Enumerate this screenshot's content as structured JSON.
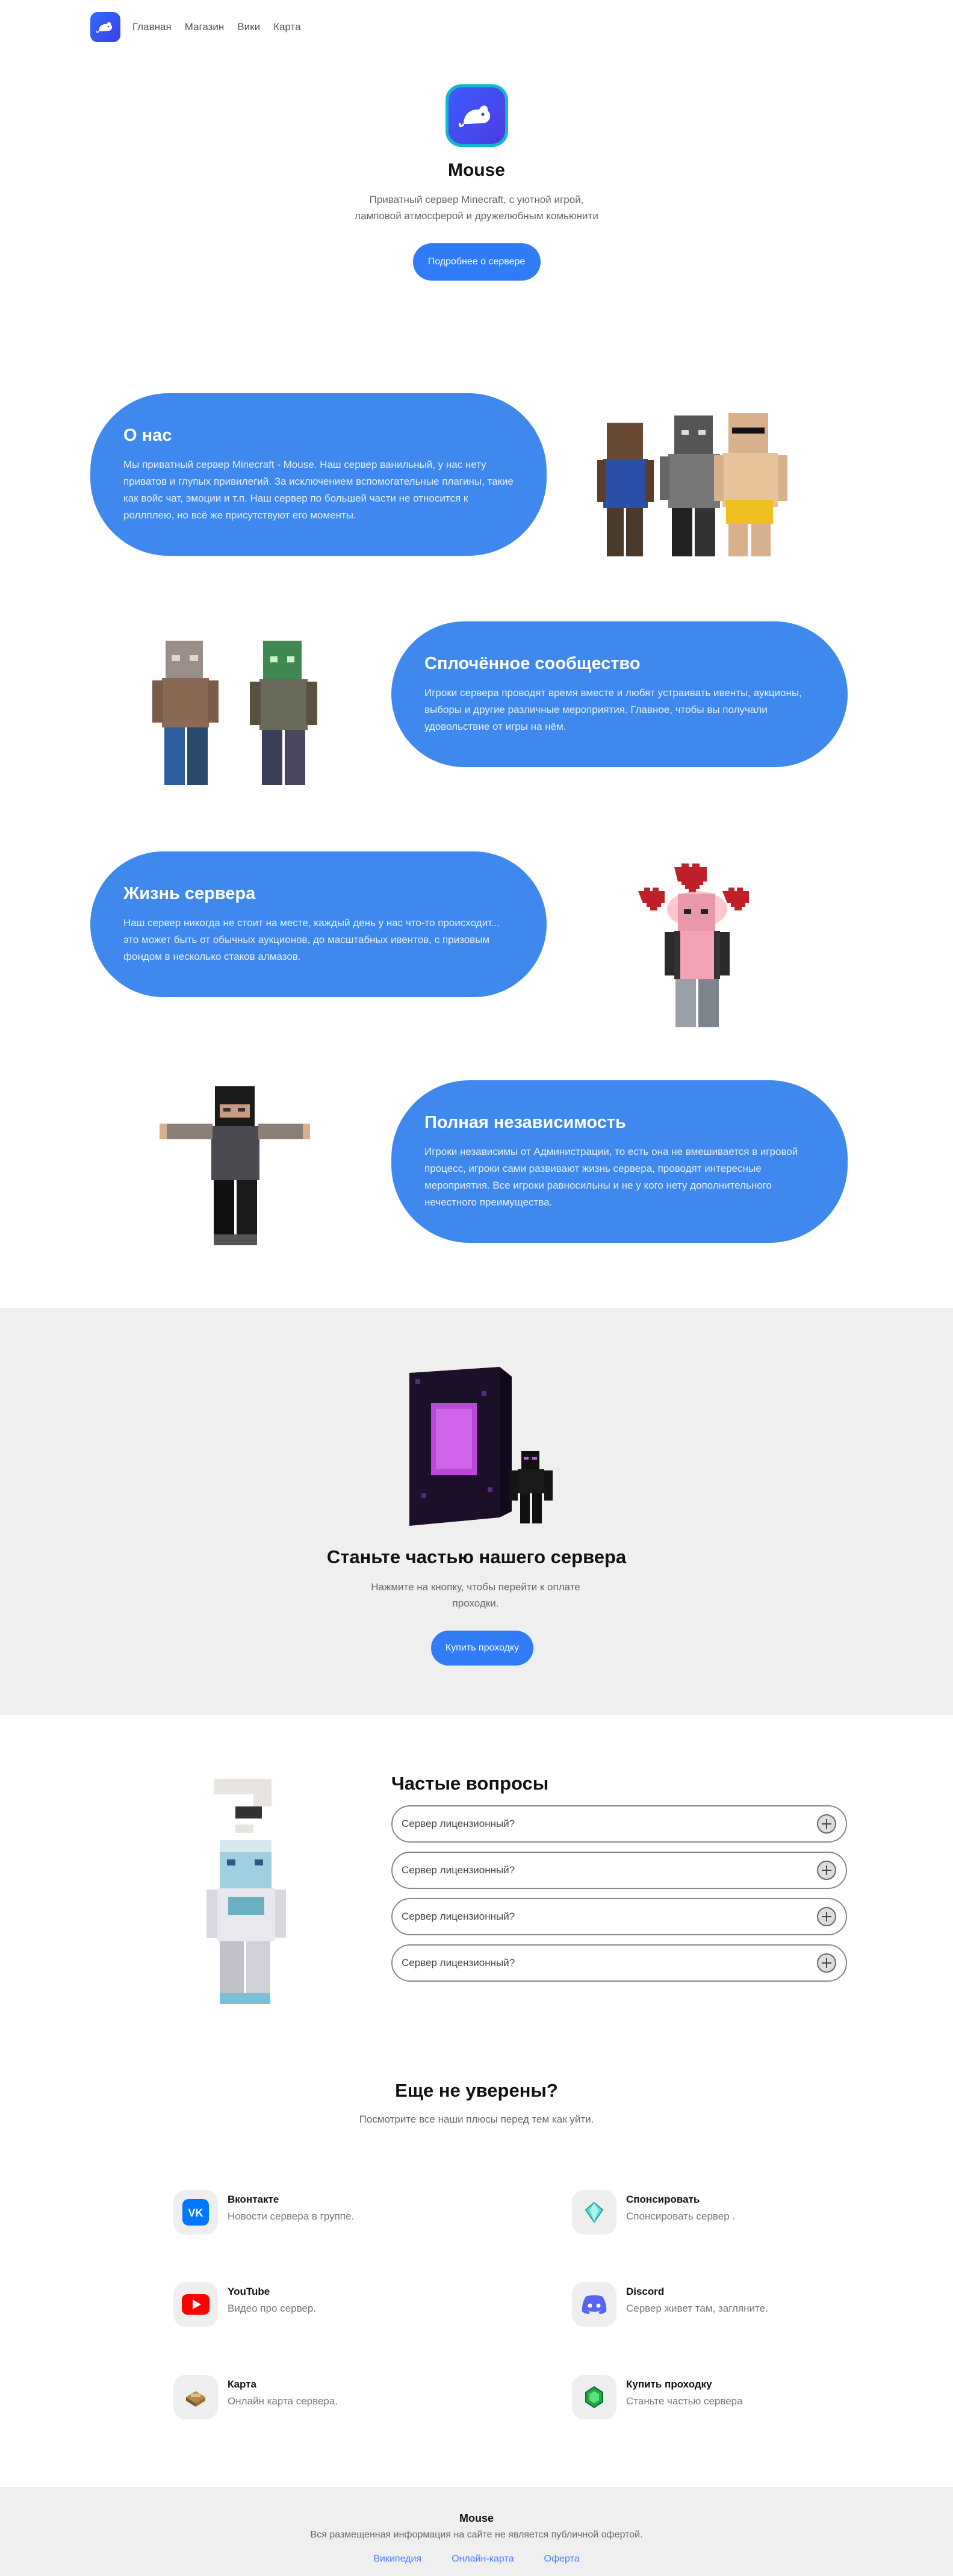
{
  "nav": {
    "links": [
      "Главная",
      "Магазин",
      "Вики",
      "Карта"
    ]
  },
  "hero": {
    "title": "Mouse",
    "description": "Приватный сервер Minecraft, с уютной игрой, ламповой атмосферой и дружелюбным комьюнити",
    "button": "Подробнее о сервере"
  },
  "sections": [
    {
      "title": "О нас",
      "text": "Мы приватный сервер Minecraft - Mouse. Наш сервер ванильный, у нас нету приватов и глупых привилегий. За исключением вспомогательные плагины, такие как войс чат, эмоции и т.п. Наш сервер по большей части не относится к роллплею, но всё же присутствуют его моменты."
    },
    {
      "title": "Сплочённое сообщество",
      "text": "Игроки сервера проводят время вместе и любят устраивать ивенты, аукционы, выборы и другие различные мероприятия. Главное, чтобы вы получали удовольствие от игры на нём."
    },
    {
      "title": "Жизнь сервера",
      "text": "Наш сервер никогда не стоит на месте, каждый день у нас что-то происходит... это может быть от обычных аукционов, до масштабных ивентов, с призовым фондом в несколько стаков алмазов."
    },
    {
      "title": "Полная независимость",
      "text": "Игроки независимы от Администрации, то есть она не вмешивается в игровой процесс, игроки сами развивают жизнь сервера, проводят интересные мероприятия. Все игроки равносильны и не у кого нету дополнительного нечестного преимущества."
    }
  ],
  "join": {
    "title": "Станьте частью нашего сервера",
    "text": "Нажмите на кнопку, чтобы перейти к оплате проходки.",
    "button": "Купить проходку"
  },
  "faq": {
    "title": "Частые вопросы",
    "items": [
      "Сервер лицензионный?",
      "Сервер лицензионный?",
      "Сервер лицензионный?",
      "Сервер лицензионный?"
    ]
  },
  "unsure": {
    "title": "Еще не уверены?",
    "subtitle": "Посмотрите все наши плюсы перед тем как уйти.",
    "links": [
      {
        "title": "Вконтакте",
        "desc": "Новости сервера в группе.",
        "icon": "vk-icon"
      },
      {
        "title": "Спонсировать",
        "desc": "Спонсировать сервер .",
        "icon": "diamond-icon"
      },
      {
        "title": "YouTube",
        "desc": "Видео про сервер.",
        "icon": "youtube-icon"
      },
      {
        "title": "Discord",
        "desc": "Сервер живет там, загляните.",
        "icon": "discord-icon"
      },
      {
        "title": "Карта",
        "desc": "Онлайн карта сервера.",
        "icon": "map-icon"
      },
      {
        "title": "Купить проходку",
        "desc": "Станьте частью сервера",
        "icon": "emerald-icon"
      }
    ]
  },
  "footer": {
    "title": "Mouse",
    "subtitle": "Вся размещенная информация на сайте не является публичной офертой.",
    "links": [
      "Википедия",
      "Онлайн-карта",
      "Оферта"
    ]
  },
  "colors": {
    "accent": "#2f7cf6",
    "pill": "#3f89ee",
    "grey_bg": "#efefef"
  }
}
